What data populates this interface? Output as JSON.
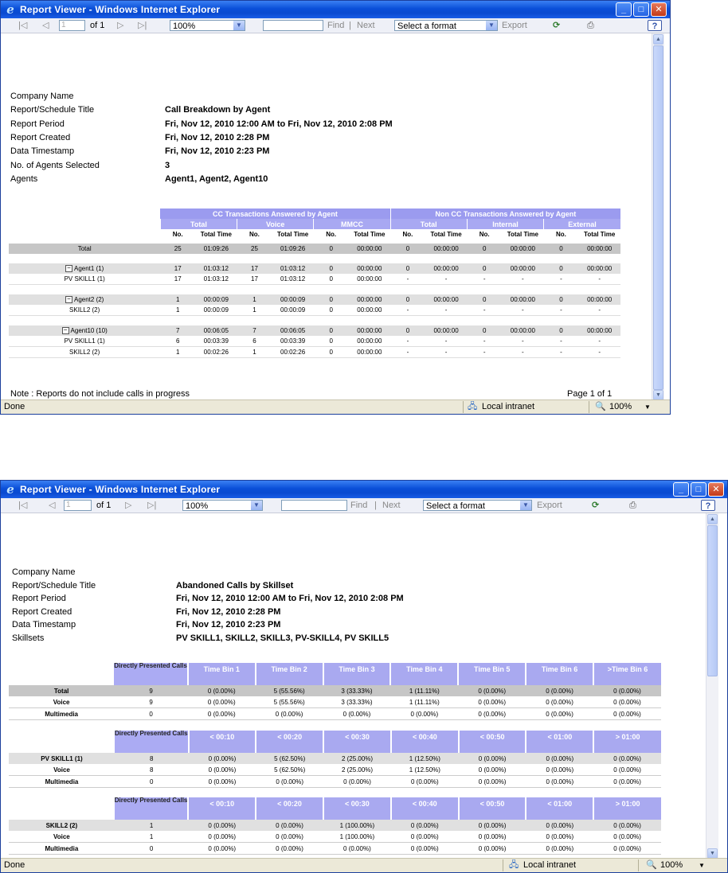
{
  "window1": {
    "title": "Report Viewer - Windows Internet Explorer",
    "toolbar": {
      "page_value": "1",
      "page_of": "of 1",
      "zoom": "100%",
      "find": "Find",
      "next": "Next",
      "format": "Select a format",
      "export": "Export"
    },
    "meta": [
      {
        "label": "Company Name",
        "value": ""
      },
      {
        "label": "Report/Schedule Title",
        "value": "Call Breakdown by Agent"
      },
      {
        "label": "Report Period",
        "value": "Fri, Nov 12, 2010 12:00 AM to Fri, Nov 12, 2010 2:08 PM"
      },
      {
        "label": "Report Created",
        "value": "Fri, Nov 12, 2010 2:28 PM"
      },
      {
        "label": "Data Timestamp",
        "value": "Fri, Nov 12, 2010 2:23 PM"
      },
      {
        "label": "No. of Agents Selected",
        "value": "3"
      },
      {
        "label": "Agents",
        "value": "Agent1, Agent2, Agent10"
      }
    ],
    "table": {
      "group1": "CC Transactions Answered by Agent",
      "group2": "Non CC Transactions Answered by Agent",
      "subs": [
        "Total",
        "Voice",
        "MMCC",
        "Total",
        "Internal",
        "External"
      ],
      "cols": [
        "No.",
        "Total Time",
        "No.",
        "Total Time",
        "No.",
        "Total Time",
        "No.",
        "Total Time",
        "No.",
        "Total Time",
        "No.",
        "Total Time"
      ],
      "rows": [
        {
          "kind": "total",
          "label": "Total",
          "cells": [
            "25",
            "01:09:26",
            "25",
            "01:09:26",
            "0",
            "00:00:00",
            "0",
            "00:00:00",
            "0",
            "00:00:00",
            "0",
            "00:00:00"
          ]
        },
        {
          "kind": "gap"
        },
        {
          "kind": "agent",
          "label": "Agent1 (1)",
          "cells": [
            "17",
            "01:03:12",
            "17",
            "01:03:12",
            "0",
            "00:00:00",
            "0",
            "00:00:00",
            "0",
            "00:00:00",
            "0",
            "00:00:00"
          ]
        },
        {
          "kind": "skill",
          "label": "PV SKILL1 (1)",
          "cells": [
            "17",
            "01:03:12",
            "17",
            "01:03:12",
            "0",
            "00:00:00",
            "-",
            "-",
            "-",
            "-",
            "-",
            "-"
          ]
        },
        {
          "kind": "gap"
        },
        {
          "kind": "agent",
          "label": "Agent2 (2)",
          "cells": [
            "1",
            "00:00:09",
            "1",
            "00:00:09",
            "0",
            "00:00:00",
            "0",
            "00:00:00",
            "0",
            "00:00:00",
            "0",
            "00:00:00"
          ]
        },
        {
          "kind": "skill",
          "label": "SKILL2 (2)",
          "cells": [
            "1",
            "00:00:09",
            "1",
            "00:00:09",
            "0",
            "00:00:00",
            "-",
            "-",
            "-",
            "-",
            "-",
            "-"
          ]
        },
        {
          "kind": "gap"
        },
        {
          "kind": "agent",
          "label": "Agent10 (10)",
          "cells": [
            "7",
            "00:06:05",
            "7",
            "00:06:05",
            "0",
            "00:00:00",
            "0",
            "00:00:00",
            "0",
            "00:00:00",
            "0",
            "00:00:00"
          ]
        },
        {
          "kind": "skill",
          "label": "PV SKILL1 (1)",
          "cells": [
            "6",
            "00:03:39",
            "6",
            "00:03:39",
            "0",
            "00:00:00",
            "-",
            "-",
            "-",
            "-",
            "-",
            "-"
          ]
        },
        {
          "kind": "skill",
          "label": "SKILL2 (2)",
          "cells": [
            "1",
            "00:02:26",
            "1",
            "00:02:26",
            "0",
            "00:00:00",
            "-",
            "-",
            "-",
            "-",
            "-",
            "-"
          ]
        }
      ]
    },
    "note": "Note : Reports do not include calls in progress",
    "page": "Page 1 of 1",
    "status": {
      "done": "Done",
      "zone": "Local intranet",
      "zoom": "100%"
    }
  },
  "window2": {
    "title": "Report Viewer - Windows Internet Explorer",
    "toolbar": {
      "page_value": "1",
      "page_of": "of 1",
      "zoom": "100%",
      "find": "Find",
      "next": "Next",
      "format": "Select a format",
      "export": "Export"
    },
    "meta": [
      {
        "label": "Company Name",
        "value": ""
      },
      {
        "label": "Report/Schedule Title",
        "value": "Abandoned Calls by Skillset"
      },
      {
        "label": "Report Period",
        "value": "Fri, Nov 12, 2010 12:00 AM to Fri, Nov 12, 2010 2:08 PM"
      },
      {
        "label": "Report Created",
        "value": "Fri, Nov 12, 2010 2:28 PM"
      },
      {
        "label": "Data Timestamp",
        "value": "Fri, Nov 12, 2010 2:23 PM"
      },
      {
        "label": "Skillsets",
        "value": "PV SKILL1, SKILL2, SKILL3, PV-SKILL4, PV SKILL5"
      }
    ],
    "blocks": [
      {
        "head_dp": "Directly Presented Calls",
        "heads": [
          "Time Bin 1",
          "Time Bin 2",
          "Time Bin 3",
          "Time Bin 4",
          "Time Bin 5",
          "Time Bin 6",
          ">Time Bin 6"
        ],
        "rows": [
          {
            "kind": "total",
            "label": "Total",
            "dp": "9",
            "cells": [
              "0 (0.00%)",
              "5 (55.56%)",
              "3 (33.33%)",
              "1 (11.11%)",
              "0 (0.00%)",
              "0 (0.00%)",
              "0 (0.00%)"
            ]
          },
          {
            "kind": "row",
            "label": "Voice",
            "dp": "9",
            "cells": [
              "0 (0.00%)",
              "5 (55.56%)",
              "3 (33.33%)",
              "1 (11.11%)",
              "0 (0.00%)",
              "0 (0.00%)",
              "0 (0.00%)"
            ]
          },
          {
            "kind": "row",
            "label": "Multimedia",
            "dp": "0",
            "cells": [
              "0 (0.00%)",
              "0 (0.00%)",
              "0 (0.00%)",
              "0 (0.00%)",
              "0 (0.00%)",
              "0 (0.00%)",
              "0 (0.00%)"
            ]
          }
        ]
      },
      {
        "head_dp": "Directly Presented Calls",
        "heads": [
          "< 00:10",
          "< 00:20",
          "< 00:30",
          "< 00:40",
          "< 00:50",
          "< 01:00",
          "> 01:00"
        ],
        "rows": [
          {
            "kind": "skill",
            "label": "PV SKILL1 (1)",
            "dp": "8",
            "cells": [
              "0 (0.00%)",
              "5 (62.50%)",
              "2 (25.00%)",
              "1 (12.50%)",
              "0 (0.00%)",
              "0 (0.00%)",
              "0 (0.00%)"
            ]
          },
          {
            "kind": "row",
            "label": "Voice",
            "dp": "8",
            "cells": [
              "0 (0.00%)",
              "5 (62.50%)",
              "2 (25.00%)",
              "1 (12.50%)",
              "0 (0.00%)",
              "0 (0.00%)",
              "0 (0.00%)"
            ]
          },
          {
            "kind": "row",
            "label": "Multimedia",
            "dp": "0",
            "cells": [
              "0 (0.00%)",
              "0 (0.00%)",
              "0 (0.00%)",
              "0 (0.00%)",
              "0 (0.00%)",
              "0 (0.00%)",
              "0 (0.00%)"
            ]
          }
        ]
      },
      {
        "head_dp": "Directly Presented Calls",
        "heads": [
          "< 00:10",
          "< 00:20",
          "< 00:30",
          "< 00:40",
          "< 00:50",
          "< 01:00",
          "> 01:00"
        ],
        "rows": [
          {
            "kind": "skill",
            "label": "SKILL2 (2)",
            "dp": "1",
            "cells": [
              "0 (0.00%)",
              "0 (0.00%)",
              "1 (100.00%)",
              "0 (0.00%)",
              "0 (0.00%)",
              "0 (0.00%)",
              "0 (0.00%)"
            ]
          },
          {
            "kind": "row",
            "label": "Voice",
            "dp": "1",
            "cells": [
              "0 (0.00%)",
              "0 (0.00%)",
              "1 (100.00%)",
              "0 (0.00%)",
              "0 (0.00%)",
              "0 (0.00%)",
              "0 (0.00%)"
            ]
          },
          {
            "kind": "row",
            "label": "Multimedia",
            "dp": "0",
            "cells": [
              "0 (0.00%)",
              "0 (0.00%)",
              "0 (0.00%)",
              "0 (0.00%)",
              "0 (0.00%)",
              "0 (0.00%)",
              "0 (0.00%)"
            ]
          }
        ]
      }
    ],
    "status": {
      "done": "Done",
      "zone": "Local intranet",
      "zoom": "100%"
    }
  }
}
